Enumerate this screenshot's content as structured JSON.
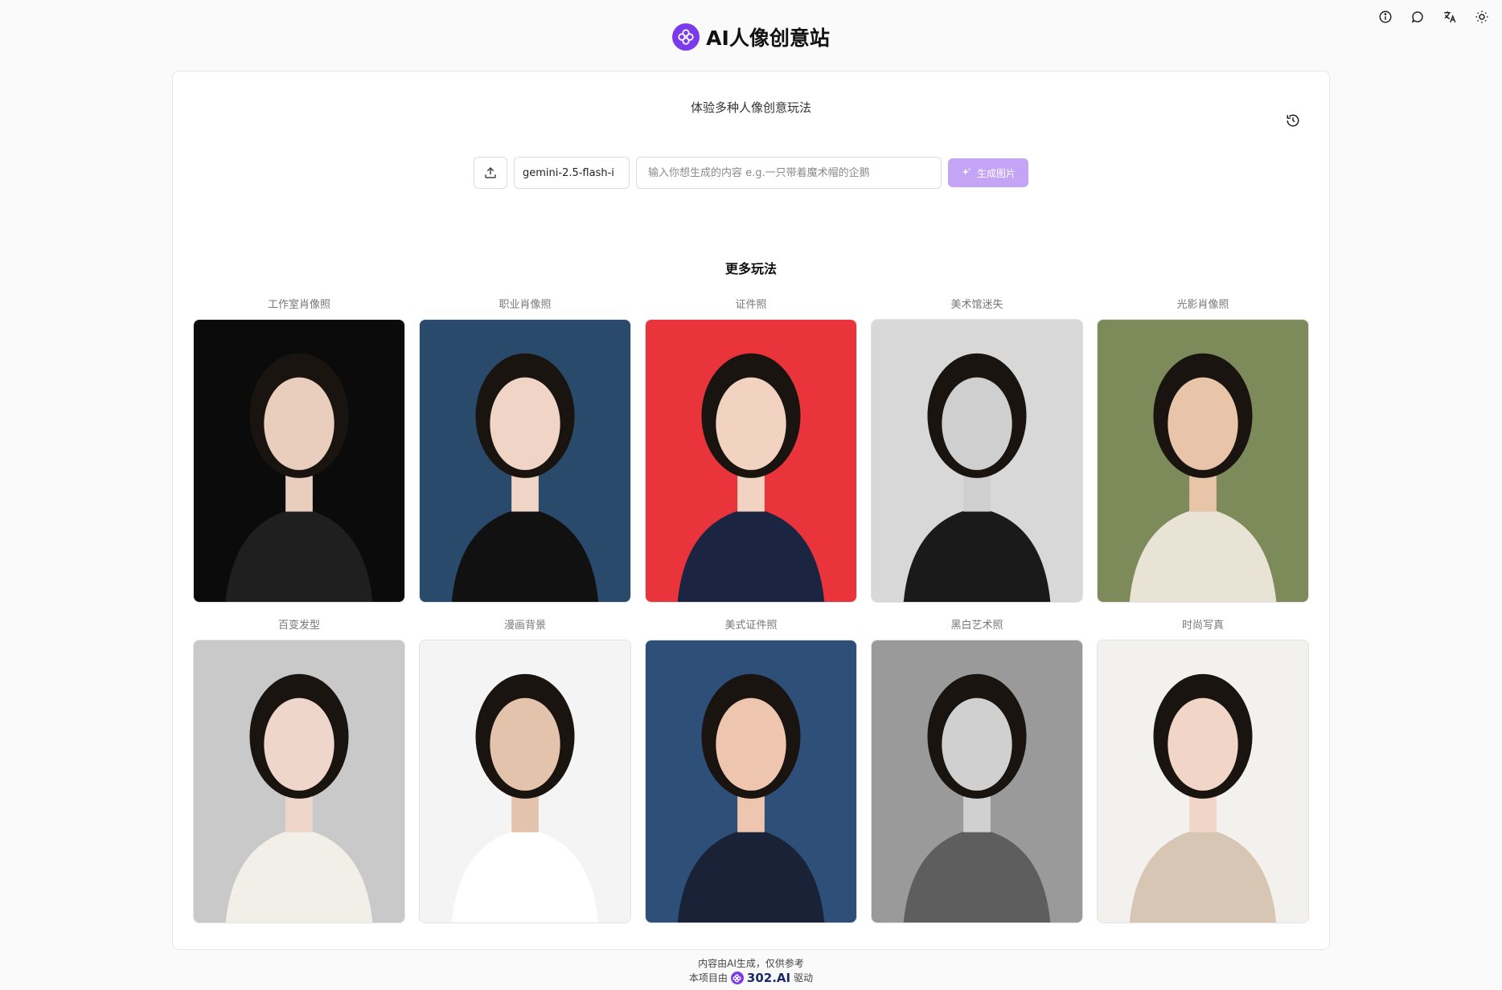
{
  "header": {
    "title": "AI人像创意站"
  },
  "toolbar_icons": [
    "info-icon",
    "chat-icon",
    "translate-icon",
    "theme-icon"
  ],
  "main": {
    "subtitle": "体验多种人像创意玩法",
    "model_select": {
      "value": "gemini-2.5-flash-i"
    },
    "prompt": {
      "placeholder": "输入你想生成的内容 e.g.一只带着魔术帽的企鹅"
    },
    "generate_label": "生成图片",
    "more_title": "更多玩法"
  },
  "styles": [
    {
      "label": "工作室肖像照",
      "bg": "#0b0b0b",
      "accent": "#1f1f1f",
      "skin": "#e9cdbd"
    },
    {
      "label": "职业肖像照",
      "bg": "#2a4a6b",
      "accent": "#111111",
      "skin": "#f0d4c6"
    },
    {
      "label": "证件照",
      "bg": "#e8343a",
      "accent": "#1b2440",
      "skin": "#f2d2c0"
    },
    {
      "label": "美术馆迷失",
      "bg": "#d8d8d8",
      "accent": "#1a1a1a",
      "skin": "#cfcfcf"
    },
    {
      "label": "光影肖像照",
      "bg": "#7d8a5a",
      "accent": "#e9e3d6",
      "skin": "#e8c4a8"
    },
    {
      "label": "百变发型",
      "bg": "#c9c9c9",
      "accent": "#f2efe9",
      "skin": "#efd6ca"
    },
    {
      "label": "漫画背景",
      "bg": "#f4f4f4",
      "accent": "#ffffff",
      "skin": "#e4c3ad"
    },
    {
      "label": "美式证件照",
      "bg": "#2e4f78",
      "accent": "#1a2238",
      "skin": "#eec5ae"
    },
    {
      "label": "黑白艺术照",
      "bg": "#9a9a9a",
      "accent": "#5e5e5e",
      "skin": "#d0d0d0"
    },
    {
      "label": "时尚写真",
      "bg": "#f3f1ee",
      "accent": "#d8c6b4",
      "skin": "#f1d6c7"
    }
  ],
  "footer": {
    "disclaimer": "内容由AI生成，仅供参考",
    "powered_prefix": "本项目由",
    "brand": "302.AI",
    "powered_suffix": "驱动"
  }
}
